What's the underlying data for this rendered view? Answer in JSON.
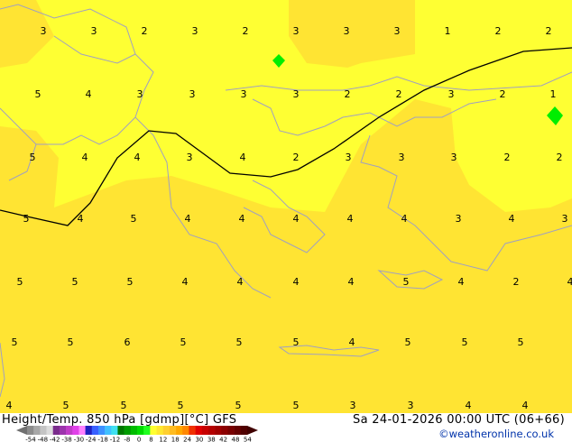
{
  "title": "Height/Temp. 850 hPa [gdmp][°C] GFS",
  "datetime": "Sa 24-01-2026 00:00 UTC (06+66)",
  "credit": "©weatheronline.co.uk",
  "colors": {
    "field_light": "#feff33",
    "field_dark": "#ffe433",
    "coastline": "#a0a0c0",
    "isotherm": "#000000",
    "marker": "#00ee00"
  },
  "legend": {
    "ticks": [
      "-54",
      "-48",
      "-42",
      "-38",
      "-30",
      "-24",
      "-18",
      "-12",
      "-8",
      "0",
      "8",
      "12",
      "18",
      "24",
      "30",
      "38",
      "42",
      "48",
      "54"
    ],
    "colors": [
      "#8c8c8c",
      "#a8a8a8",
      "#c4c4c4",
      "#dcdcdc",
      "#7a2c8c",
      "#9c34ac",
      "#c03cc8",
      "#e040e8",
      "#ff80ff",
      "#2020c0",
      "#3860ff",
      "#3c90ff",
      "#40c0ff",
      "#40e0f0",
      "#007800",
      "#009c00",
      "#00bc00",
      "#00dc00",
      "#20ff20",
      "#ffff30",
      "#ffe830",
      "#ffd030",
      "#ffbc20",
      "#ffa800",
      "#ff8800",
      "#f03000",
      "#e00000",
      "#c80000",
      "#b40000",
      "#a00000",
      "#8c0000",
      "#780000",
      "#640000",
      "#500000"
    ]
  },
  "map_values": [
    "3",
    "3",
    "2",
    "3",
    "2",
    "3",
    "3",
    "3",
    "1",
    "2",
    "2",
    "5",
    "4",
    "3",
    "3",
    "3",
    "3",
    "2",
    "2",
    "3",
    "2",
    "1",
    "5",
    "4",
    "4",
    "3",
    "4",
    "2",
    "3",
    "3",
    "3",
    "2",
    "2",
    "5",
    "4",
    "5",
    "4",
    "4",
    "4",
    "4",
    "4",
    "3",
    "4",
    "3",
    "5",
    "5",
    "5",
    "4",
    "4",
    "4",
    "4",
    "5",
    "4",
    "2",
    "4",
    "5",
    "5",
    "6",
    "5",
    "5",
    "5",
    "4",
    "5",
    "5",
    "5",
    "4",
    "5",
    "5",
    "5",
    "5",
    "5",
    "3",
    "3",
    "4",
    "4"
  ]
}
